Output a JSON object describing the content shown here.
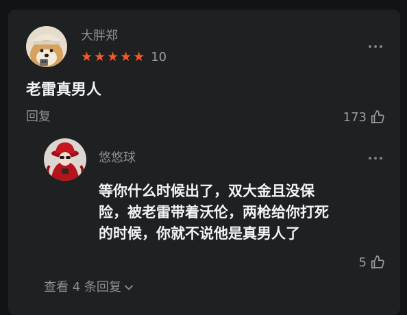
{
  "comment": {
    "username": "大胖郑",
    "stars": [
      "★",
      "★",
      "★",
      "★",
      "★"
    ],
    "score": "10",
    "text": "老雷真男人",
    "reply_label": "回复",
    "likes": "173",
    "avatar_icon": "shiba-dog-avatar"
  },
  "reply": {
    "username": "悠悠球",
    "text_lines": [
      "等你什么时候出了，双大金且没保",
      "险，被老雷带着沃伦，两枪给你打死",
      "的时候，你就不说他是真男人了"
    ],
    "likes": "5",
    "avatar_icon": "girl-red-hat-avatar"
  },
  "view_replies_label": "查看 4 条回复",
  "colors": {
    "background": "#121314",
    "card": "#1f2021",
    "star": "#f0592b",
    "text": "#f2f3f5",
    "muted": "#8d9096"
  }
}
